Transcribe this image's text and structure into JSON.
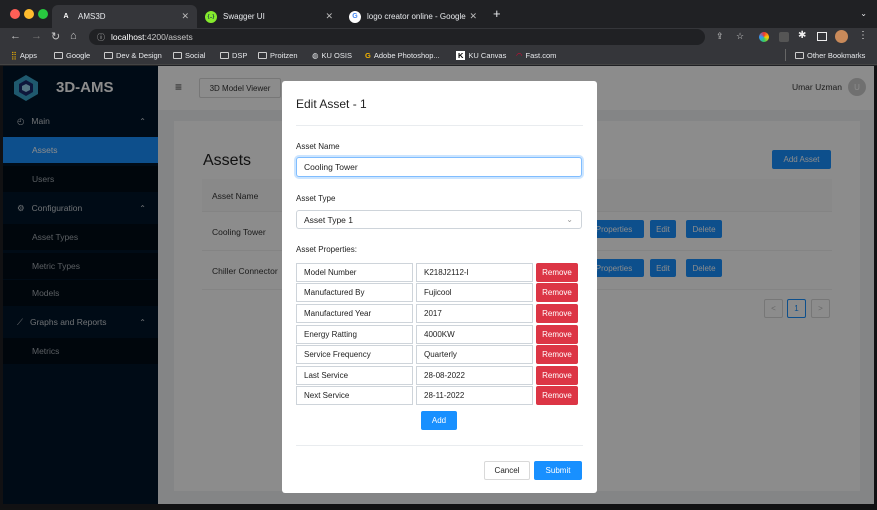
{
  "browser": {
    "tabs": [
      {
        "title": "AMS3D",
        "favicon": "A"
      },
      {
        "title": "Swagger UI",
        "favicon": "{..}"
      },
      {
        "title": "logo creator online - Google Se",
        "favicon": "G"
      }
    ],
    "new_tab": "+",
    "url_host": "localhost",
    "url_path": ":4200/assets",
    "bookmarks": [
      "Apps",
      "Google",
      "Dev & Design",
      "Social",
      "DSP",
      "Proitzen",
      "KU OSIS",
      "Adobe Photoshop...",
      "KU Canvas",
      "Fast.com"
    ],
    "other_bookmarks": "Other Bookmarks"
  },
  "app": {
    "brand": "3D-AMS",
    "sidebar": {
      "main": "Main",
      "assets": "Assets",
      "users": "Users",
      "configuration": "Configuration",
      "asset_types": "Asset Types",
      "metric_types": "Metric Types",
      "models": "Models",
      "graphs": "Graphs and Reports",
      "metrics": "Metrics"
    },
    "topbar": {
      "viewer_button": "3D Model Viewer",
      "user_name": "Umar Uzman",
      "avatar_initial": "U"
    },
    "page_title": "Assets",
    "add_asset": "Add Asset",
    "table_header": "Asset Name",
    "rows": [
      {
        "name": "Cooling Tower",
        "properties": "Properties",
        "edit": "Edit",
        "delete": "Delete"
      },
      {
        "name": "Chiller Connector",
        "properties": "Properties",
        "edit": "Edit",
        "delete": "Delete"
      }
    ],
    "pagination": {
      "prev": "<",
      "current": "1",
      "next": ">"
    }
  },
  "modal": {
    "title": "Edit Asset - 1",
    "name_label": "Asset Name",
    "name_value": "Cooling Tower",
    "type_label": "Asset Type",
    "type_value": "Asset Type 1",
    "props_label": "Asset Properties:",
    "remove_label": "Remove",
    "properties": [
      {
        "key": "Model Number",
        "value": "K218J2112-I"
      },
      {
        "key": "Manufactured By",
        "value": "Fujicool"
      },
      {
        "key": "Manufactured Year",
        "value": "2017"
      },
      {
        "key": "Energy Ratting",
        "value": "4000KW"
      },
      {
        "key": "Service Frequency",
        "value": "Quarterly"
      },
      {
        "key": "Last Service",
        "value": "28-08-2022"
      },
      {
        "key": "Next Service",
        "value": "28-11-2022"
      }
    ],
    "add_label": "Add",
    "cancel_label": "Cancel",
    "submit_label": "Submit"
  },
  "colors": {
    "primary": "#1890ff",
    "danger": "#dc3545",
    "sidebar": "#001529"
  }
}
